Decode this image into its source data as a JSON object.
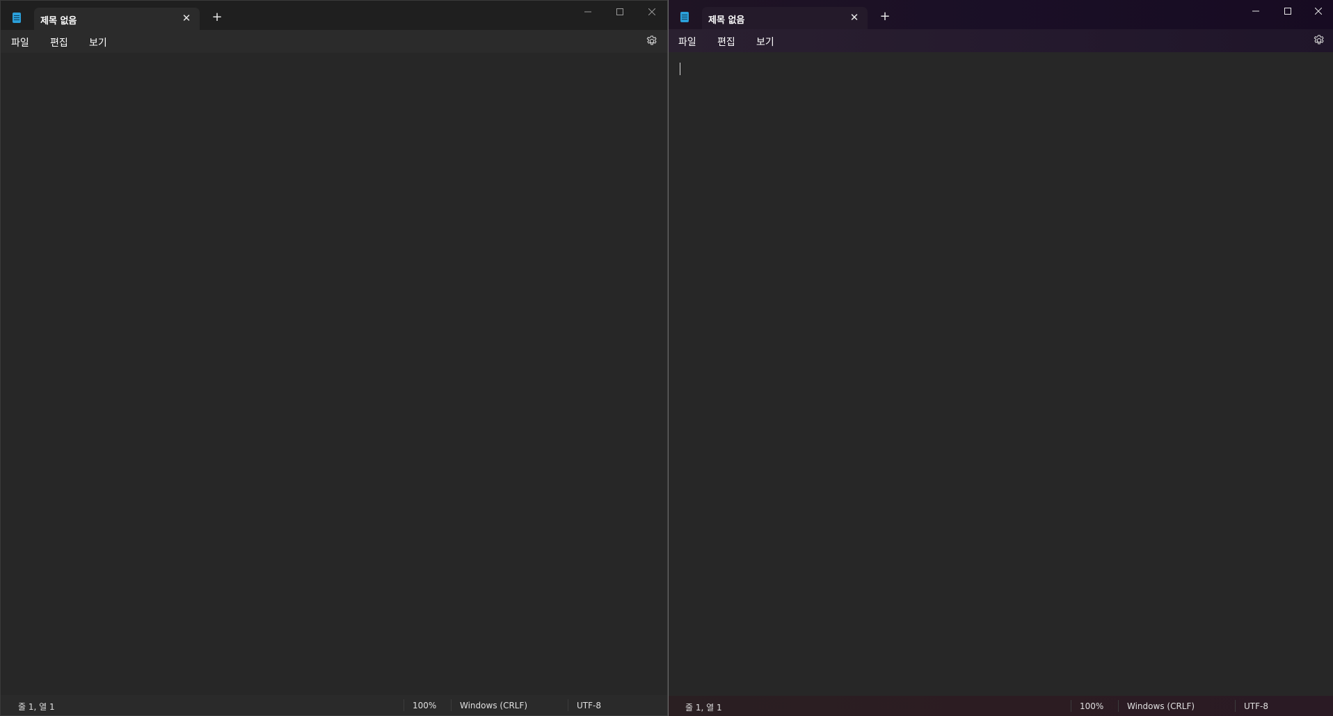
{
  "windows": [
    {
      "id": "left",
      "tab_title": "제목 없음",
      "menu": {
        "file": "파일",
        "edit": "편집",
        "view": "보기"
      },
      "status": {
        "position": "줄 1, 열 1",
        "zoom": "100%",
        "line_ending": "Windows (CRLF)",
        "encoding": "UTF-8"
      },
      "focused": false
    },
    {
      "id": "right",
      "tab_title": "제목 없음",
      "menu": {
        "file": "파일",
        "edit": "편집",
        "view": "보기"
      },
      "status": {
        "position": "줄 1, 열 1",
        "zoom": "100%",
        "line_ending": "Windows (CRLF)",
        "encoding": "UTF-8"
      },
      "focused": true
    }
  ],
  "icons": {
    "app": "notepad-icon",
    "close_tab": "close-icon",
    "new_tab": "plus-icon",
    "minimize": "minimize-icon",
    "maximize": "maximize-icon",
    "close_window": "close-icon",
    "settings": "gear-icon"
  },
  "colors": {
    "editor_bg": "#272727",
    "accent_icon": "#2b9fd9",
    "focused_titlebar": "#1a0f26"
  }
}
